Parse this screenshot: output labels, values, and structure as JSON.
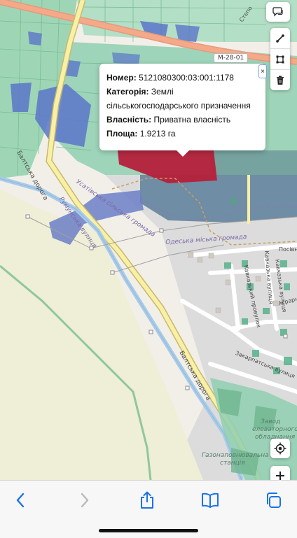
{
  "popup": {
    "number_label": "Номер:",
    "number_value": "5121080300:03:001:1178",
    "category_label": "Категорія:",
    "category_value_1": "Землі",
    "category_value_2": "сільськогосподарського призначення",
    "ownership_label": "Власність:",
    "ownership_value": "Приватна власність",
    "area_label": "Площа:",
    "area_value": "1.9213 га",
    "close_label": "×"
  },
  "map_labels": {
    "highway_shield": "М-28-01",
    "balt_road_1": "Балтська дорога",
    "balt_road_2": "Балтська дорога",
    "usativska": "Усатівська сільська громада",
    "rumunska": "Румунська вулиця",
    "odeska": "Одеська міська громада",
    "kavkazka_1": "Кавказький провулок",
    "kavkazka_2": "Кавказька вулиця",
    "kavkazka_3": "Кавказька вулиця",
    "zakarpatska": "Закарпатська вулиця",
    "posivna": "Посівн",
    "ahrarna": "Аграрн",
    "stepova": "Степо",
    "zavod_1": "Завод",
    "zavod_2": "елеваторного",
    "zavod_3": "обладнання",
    "gas_1": "Газонаповнювальна",
    "gas_2": "станція"
  },
  "icons": {
    "chat": "chat-bubble-icon",
    "line": "draw-line-icon",
    "polygon": "draw-polygon-icon",
    "trash": "trash-icon",
    "locate": "locate-me-icon",
    "zoom_in": "zoom-in-icon",
    "back": "back-chevron-icon",
    "forward": "forward-chevron-icon",
    "share": "share-icon",
    "bookmarks": "bookmarks-icon",
    "tabs": "tabs-icon"
  },
  "colors": {
    "parcel_selected": "#b5203a",
    "parcel_ag": "#7cc4a0",
    "parcel_blue": "#5b76c9",
    "road_major": "#f4a988",
    "road_yellow": "#f7f0a6",
    "canal": "#a9cbe8",
    "toolbar_accent": "#1a73e8"
  }
}
